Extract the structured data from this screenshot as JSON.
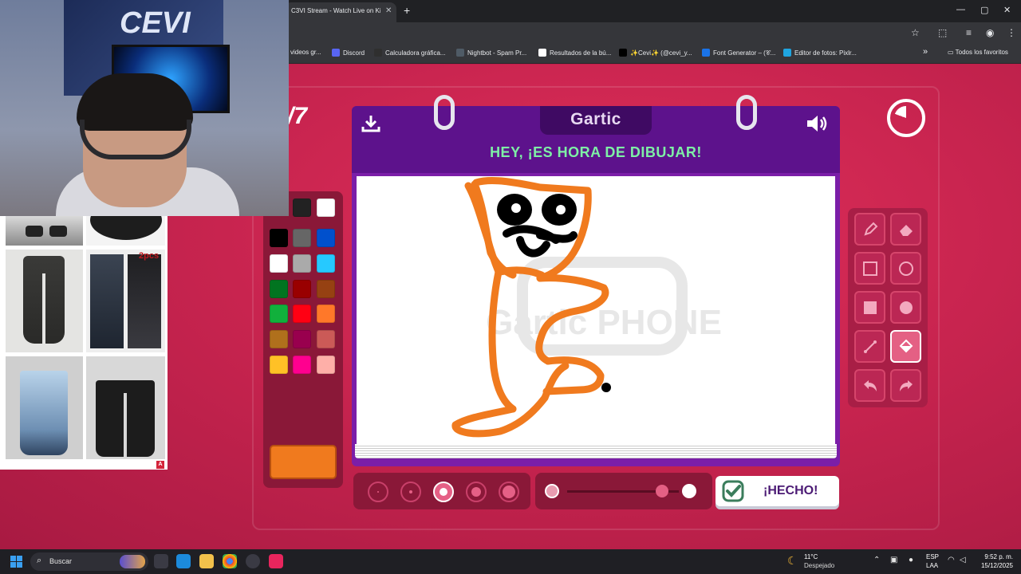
{
  "browser": {
    "tab_title": "C3VI Stream - Watch Live on Ki",
    "tab_close": "✕",
    "new_tab": "+",
    "window_controls": [
      "—",
      "▢",
      "✕"
    ],
    "bookmarks": [
      {
        "label": "videos gr...",
        "color": "#888888"
      },
      {
        "label": "Discord",
        "color": "#5865f2"
      },
      {
        "label": "Calculadora gráfica...",
        "color": "#2f2f2f"
      },
      {
        "label": "Nightbot - Spam Pr...",
        "color": "#4f5b66"
      },
      {
        "label": "Resultados de la bú...",
        "color": "#ffffff"
      },
      {
        "label": "✨Cevi✨ (@cevi_y...",
        "color": "#000000"
      },
      {
        "label": "Font Generator – (𝒞...",
        "color": "#1a73e8"
      },
      {
        "label": "Editor de fotos: Pixlr...",
        "color": "#1fa5e0"
      }
    ],
    "bookmarks_more": "»",
    "all_bookmarks": "Todos los favoritos"
  },
  "game": {
    "round": "/7",
    "logo": "Gartic",
    "instruction": "HEY, ¡ES HORA DE DIBUJAR!",
    "watermark": "Gartic PHONE",
    "done_label": "¡HECHO!",
    "selected_color": "#f07a1e",
    "brush_size_selected": 3,
    "opacity_level": 0.85,
    "selected_tool": "fill-bucket",
    "palette": [
      [
        "#222222",
        "#ffffff"
      ],
      [
        "#000000",
        "#666666",
        "#0050cd"
      ],
      [
        "#ffffff",
        "#aaaaaa",
        "#26c9ff"
      ],
      [
        "#017420",
        "#990000",
        "#964112"
      ],
      [
        "#11b03c",
        "#ff0013",
        "#ff7829"
      ],
      [
        "#b0701c",
        "#99004e",
        "#cb5a57"
      ],
      [
        "#ffc126",
        "#ff008f",
        "#feafa8"
      ]
    ],
    "tools": [
      "pencil",
      "eraser",
      "rectangle",
      "ellipse",
      "filled-rectangle",
      "filled-ellipse",
      "line",
      "fill-bucket",
      "undo",
      "redo"
    ]
  },
  "taskbar": {
    "search": "Buscar",
    "weather_temp": "11°C",
    "weather_desc": "Despejado",
    "lang1": "ESP",
    "lang2": "LAA",
    "time": "9:52 p. m.",
    "date": "15/12/2025"
  }
}
